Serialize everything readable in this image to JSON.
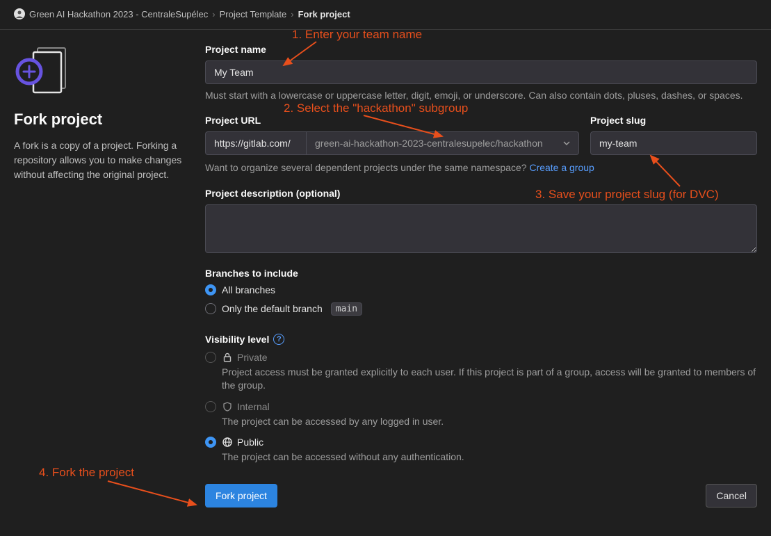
{
  "breadcrumbs": {
    "group": "Green AI Hackathon 2023 - CentraleSupélec",
    "project": "Project Template",
    "current": "Fork project"
  },
  "sidebar": {
    "title": "Fork project",
    "description": "A fork is a copy of a project. Forking a repository allows you to make changes without affecting the original project."
  },
  "form": {
    "project_name": {
      "label": "Project name",
      "value": "My Team",
      "hint": "Must start with a lowercase or uppercase letter, digit, emoji, or underscore. Can also contain dots, pluses, dashes, or spaces."
    },
    "project_url": {
      "label": "Project URL",
      "base": "https://gitlab.com/",
      "namespace": "green-ai-hackathon-2023-centralesupelec/hackathon",
      "hint_prefix": "Want to organize several dependent projects under the same namespace? ",
      "hint_link": "Create a group"
    },
    "project_slug": {
      "label": "Project slug",
      "value": "my-team"
    },
    "project_description": {
      "label": "Project description (optional)",
      "value": ""
    },
    "branches": {
      "label": "Branches to include",
      "all": "All branches",
      "default_only": "Only the default branch",
      "default_branch": "main"
    },
    "visibility": {
      "label": "Visibility level",
      "private": {
        "title": "Private",
        "desc": "Project access must be granted explicitly to each user. If this project is part of a group, access will be granted to members of the group."
      },
      "internal": {
        "title": "Internal",
        "desc": "The project can be accessed by any logged in user."
      },
      "public": {
        "title": "Public",
        "desc": "The project can be accessed without any authentication."
      }
    },
    "actions": {
      "submit": "Fork project",
      "cancel": "Cancel"
    }
  },
  "annotations": {
    "a1": "1. Enter your team name",
    "a2": "2. Select the \"hackathon\" subgroup",
    "a3": "3. Save your project slug (for DVC)",
    "a4": "4. Fork the project"
  }
}
